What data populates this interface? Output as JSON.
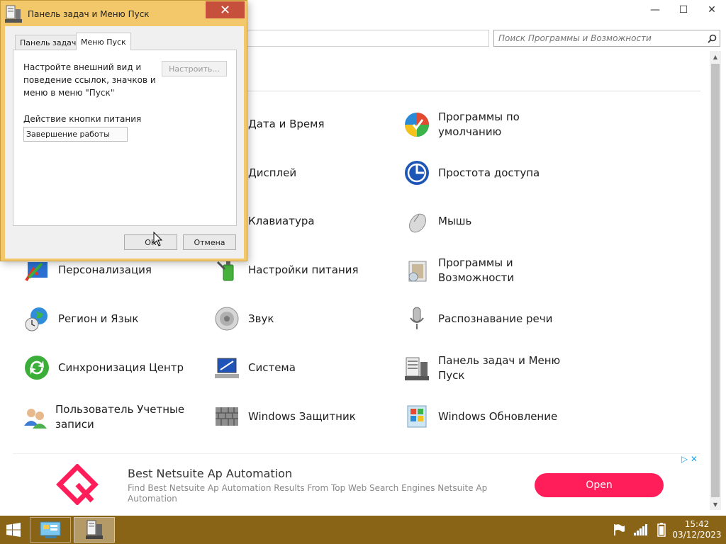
{
  "window": {
    "minimize_glyph": "—",
    "maximize_glyph": "☐",
    "close_glyph": "✕"
  },
  "search": {
    "placeholder": "Поиск Программы и Возможности",
    "icon": "search-icon"
  },
  "items": [
    {
      "label": "Дата и Время",
      "icon": "clock-calendar-icon"
    },
    {
      "label": "Программы по умолчанию",
      "icon": "default-programs-icon"
    },
    {
      "label": "Дисплей",
      "icon": "display-icon"
    },
    {
      "label": "Простота доступа",
      "icon": "ease-of-access-icon"
    },
    {
      "label": "Клавиатура",
      "icon": "keyboard-icon"
    },
    {
      "label": "Мышь",
      "icon": "mouse-icon"
    },
    {
      "label": "Персонализация",
      "icon": "personalization-icon"
    },
    {
      "label": "Настройки питания",
      "icon": "power-options-icon"
    },
    {
      "label": "Программы и Возможности",
      "icon": "programs-features-icon"
    },
    {
      "label": "Регион и Язык",
      "icon": "region-language-icon"
    },
    {
      "label": "Звук",
      "icon": "sound-icon"
    },
    {
      "label": "Распознавание речи",
      "icon": "microphone-icon"
    },
    {
      "label": "Синхронизация Центр",
      "icon": "sync-center-icon"
    },
    {
      "label": "Система",
      "icon": "system-icon"
    },
    {
      "label": "Панель задач и Меню Пуск",
      "icon": "taskbar-icon"
    },
    {
      "label": "Пользователь Учетные записи",
      "icon": "user-accounts-icon"
    },
    {
      "label": "Windows Защитник",
      "icon": "defender-icon"
    },
    {
      "label": "Windows Обновление",
      "icon": "windows-update-icon"
    }
  ],
  "ad": {
    "title": "Best Netsuite Ap Automation",
    "description": "Find Best Netsuite Ap Automation Results From Top Web Search Engines Netsuite Ap Automation",
    "button_label": "Open",
    "brand_color": "#ff1e5a"
  },
  "dialog": {
    "title": "Панель задач и Меню Пуск",
    "close_glyph": "✕",
    "tabs": [
      {
        "label": "Панель задач",
        "active": false
      },
      {
        "label": "Меню Пуск",
        "active": true
      }
    ],
    "description": "Настройте внешний вид и поведение ссылок, значков и меню в меню \"Пуск\"",
    "customize_label": "Настроить...",
    "power_label": "Действие кнопки питания",
    "power_value": "Завершение работы",
    "ok_label": "ОК",
    "cancel_label": "Отмена"
  },
  "taskbar": {
    "color": "#8a6416",
    "time": "15:42",
    "date": "03/12/2023"
  }
}
